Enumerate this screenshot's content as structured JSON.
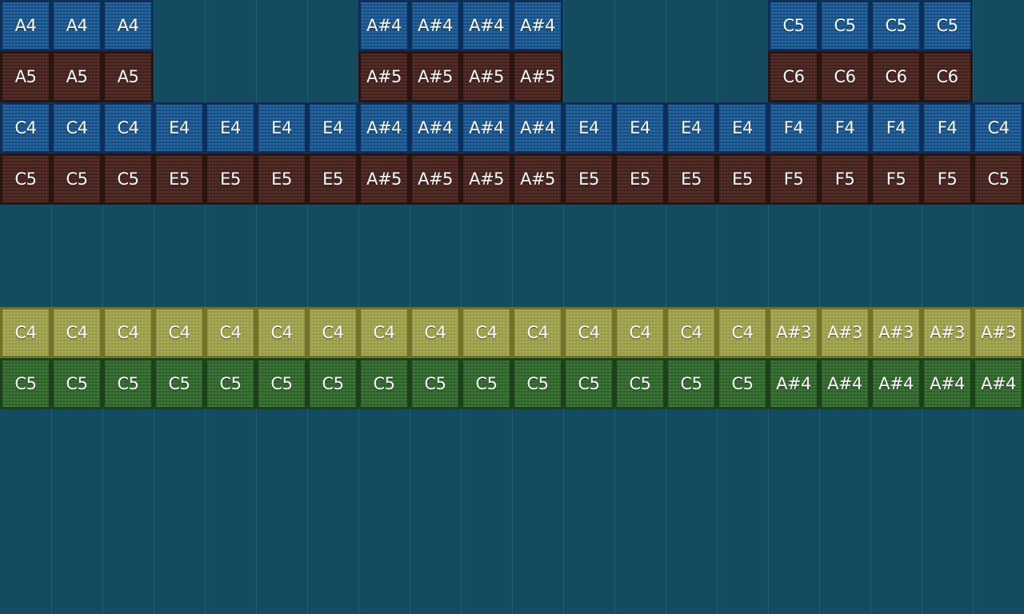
{
  "rows": [
    {
      "id": "row-1",
      "color": "blue",
      "cells": [
        "A4",
        "A4",
        "A4",
        "",
        "",
        "",
        "",
        "A#4",
        "A#4",
        "A#4",
        "A#4",
        "",
        "",
        "",
        "",
        "C5",
        "C5",
        "C5",
        "C5",
        ""
      ]
    },
    {
      "id": "row-2",
      "color": "brown",
      "cells": [
        "A5",
        "A5",
        "A5",
        "",
        "",
        "",
        "",
        "A#5",
        "A#5",
        "A#5",
        "A#5",
        "",
        "",
        "",
        "",
        "C6",
        "C6",
        "C6",
        "C6",
        ""
      ]
    },
    {
      "id": "row-3",
      "color": "blue",
      "cells": [
        "C4",
        "C4",
        "C4",
        "E4",
        "E4",
        "E4",
        "E4",
        "A#4",
        "A#4",
        "A#4",
        "A#4",
        "E4",
        "E4",
        "E4",
        "E4",
        "F4",
        "F4",
        "F4",
        "F4",
        "C4"
      ]
    },
    {
      "id": "row-4",
      "color": "brown",
      "cells": [
        "C5",
        "C5",
        "C5",
        "E5",
        "E5",
        "E5",
        "E5",
        "A#5",
        "A#5",
        "A#5",
        "A#5",
        "E5",
        "E5",
        "E5",
        "E5",
        "F5",
        "F5",
        "F5",
        "F5",
        "C5"
      ]
    },
    {
      "id": "row-5",
      "color": "",
      "cells": []
    },
    {
      "id": "row-6",
      "color": "",
      "cells": []
    },
    {
      "id": "row-7",
      "color": "yellow",
      "cells": [
        "C4",
        "C4",
        "C4",
        "C4",
        "C4",
        "C4",
        "C4",
        "C4",
        "C4",
        "C4",
        "C4",
        "C4",
        "C4",
        "C4",
        "C4",
        "A#3",
        "A#3",
        "A#3",
        "A#3",
        "A#3"
      ]
    },
    {
      "id": "row-8",
      "color": "green",
      "cells": [
        "C5",
        "C5",
        "C5",
        "C5",
        "C5",
        "C5",
        "C5",
        "C5",
        "C5",
        "C5",
        "C5",
        "C5",
        "C5",
        "C5",
        "C5",
        "A#4",
        "A#4",
        "A#4",
        "A#4",
        "A#4"
      ]
    }
  ],
  "colors": {
    "background": "#144b60",
    "blue": "#145594",
    "brown": "#4a231e",
    "yellow": "#a3a54a",
    "green": "#2f6a2a"
  }
}
